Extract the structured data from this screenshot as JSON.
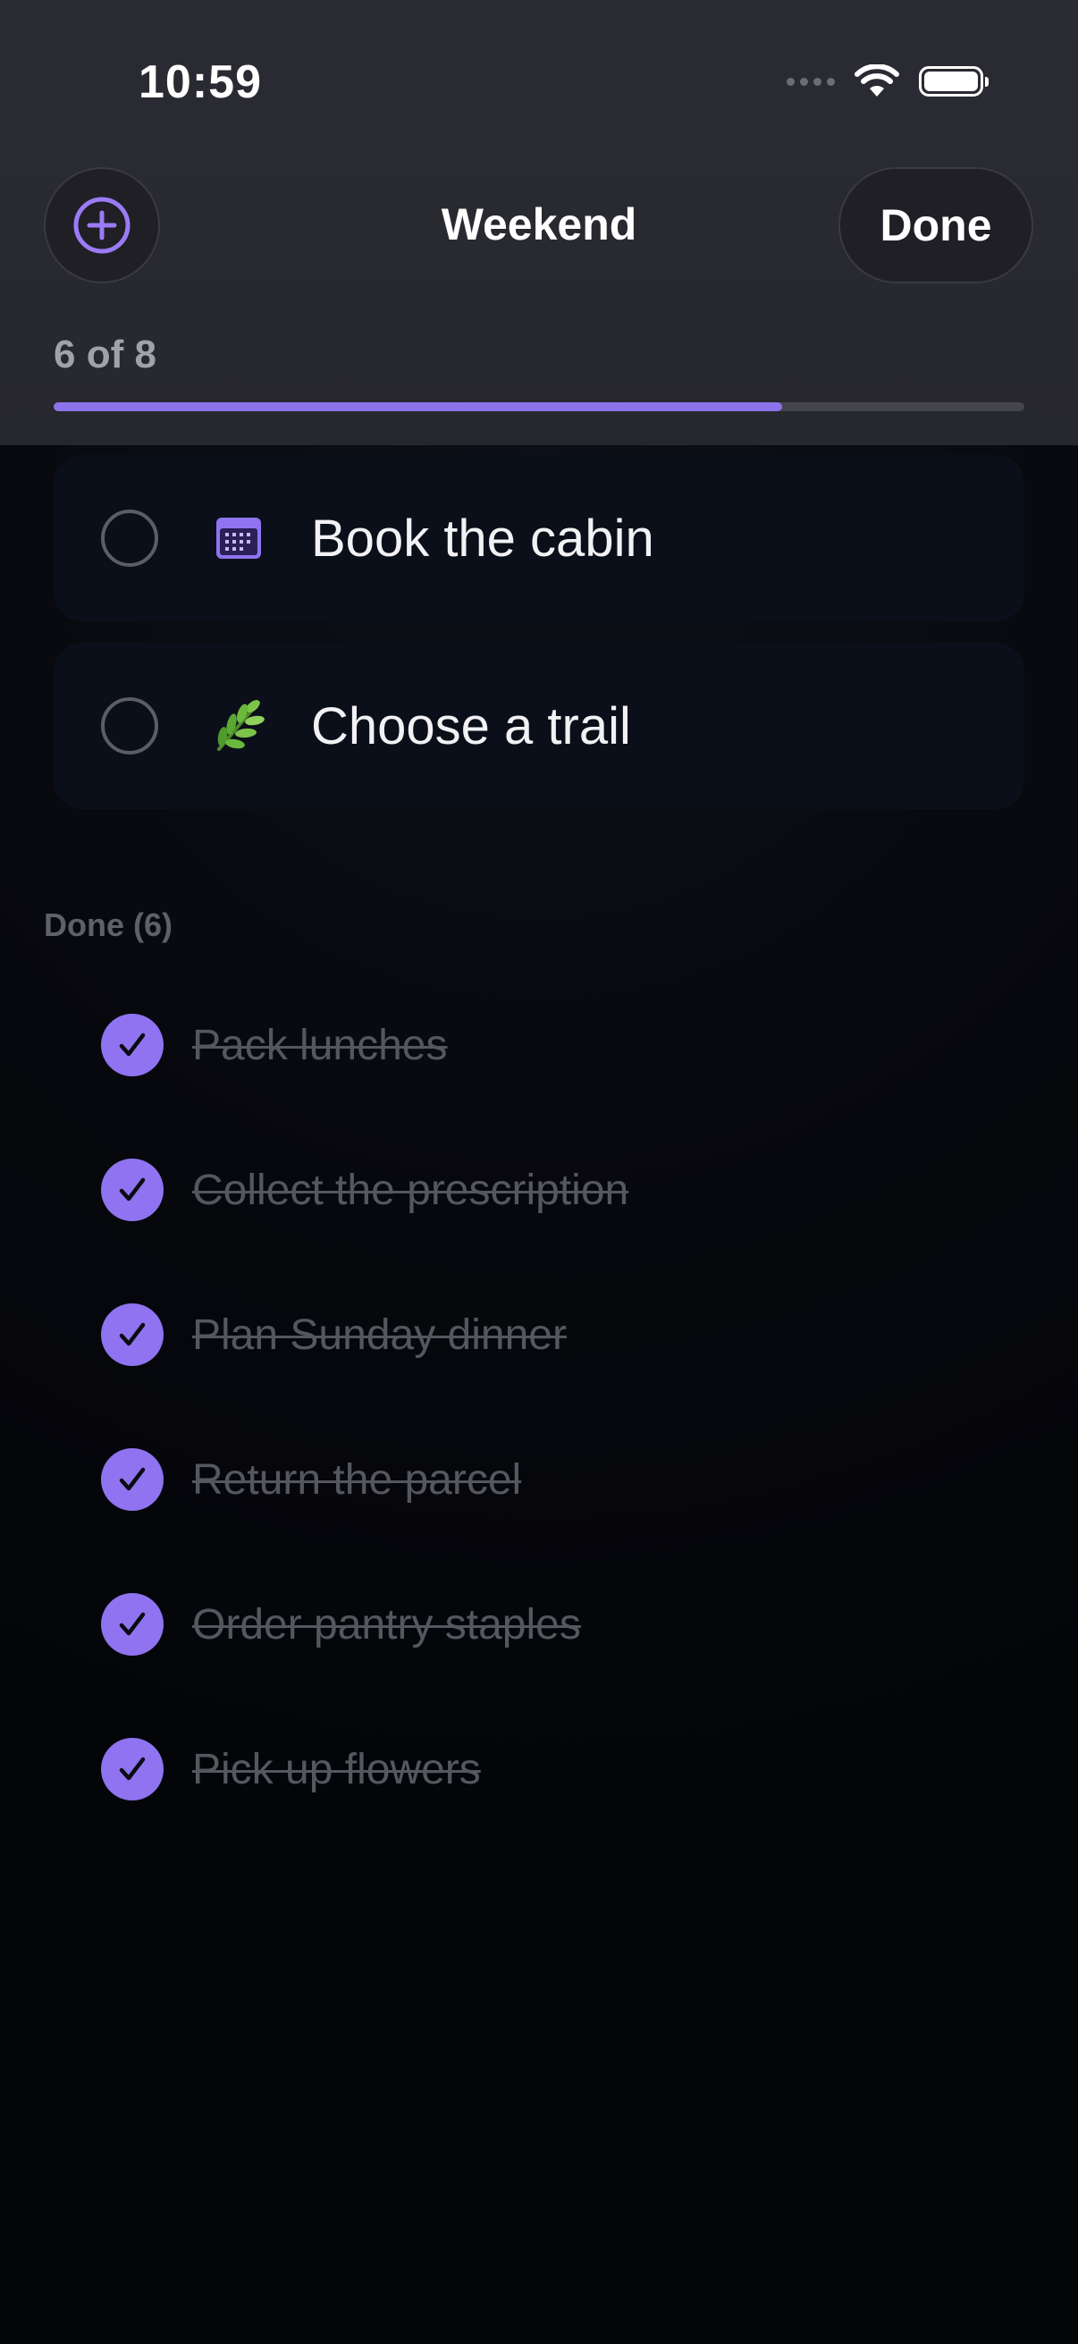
{
  "status_bar": {
    "time": "10:59",
    "icons": [
      "cellular-dots-icon",
      "wifi-icon",
      "battery-icon"
    ]
  },
  "header": {
    "title": "Weekend",
    "add_icon": "plus-circle-icon",
    "done_label": "Done"
  },
  "progress": {
    "label": "6 of 8",
    "completed": 6,
    "total": 8,
    "fraction": 0.75
  },
  "open_tasks": [
    {
      "label": "Book the cabin",
      "icon": "calendar-icon"
    },
    {
      "label": "Choose a trail",
      "icon": "herb-icon"
    }
  ],
  "done_section": {
    "header": "Done (6)",
    "items": [
      {
        "label": "Pack lunches"
      },
      {
        "label": "Collect the prescription"
      },
      {
        "label": "Plan Sunday dinner"
      },
      {
        "label": "Return the parcel"
      },
      {
        "label": "Order pantry staples"
      },
      {
        "label": "Pick up flowers"
      }
    ]
  },
  "colors": {
    "accent": "#8f73f0",
    "header_bg": "#2b2b33",
    "card_bg": "#0b0f19",
    "done_text": "#55575e"
  }
}
